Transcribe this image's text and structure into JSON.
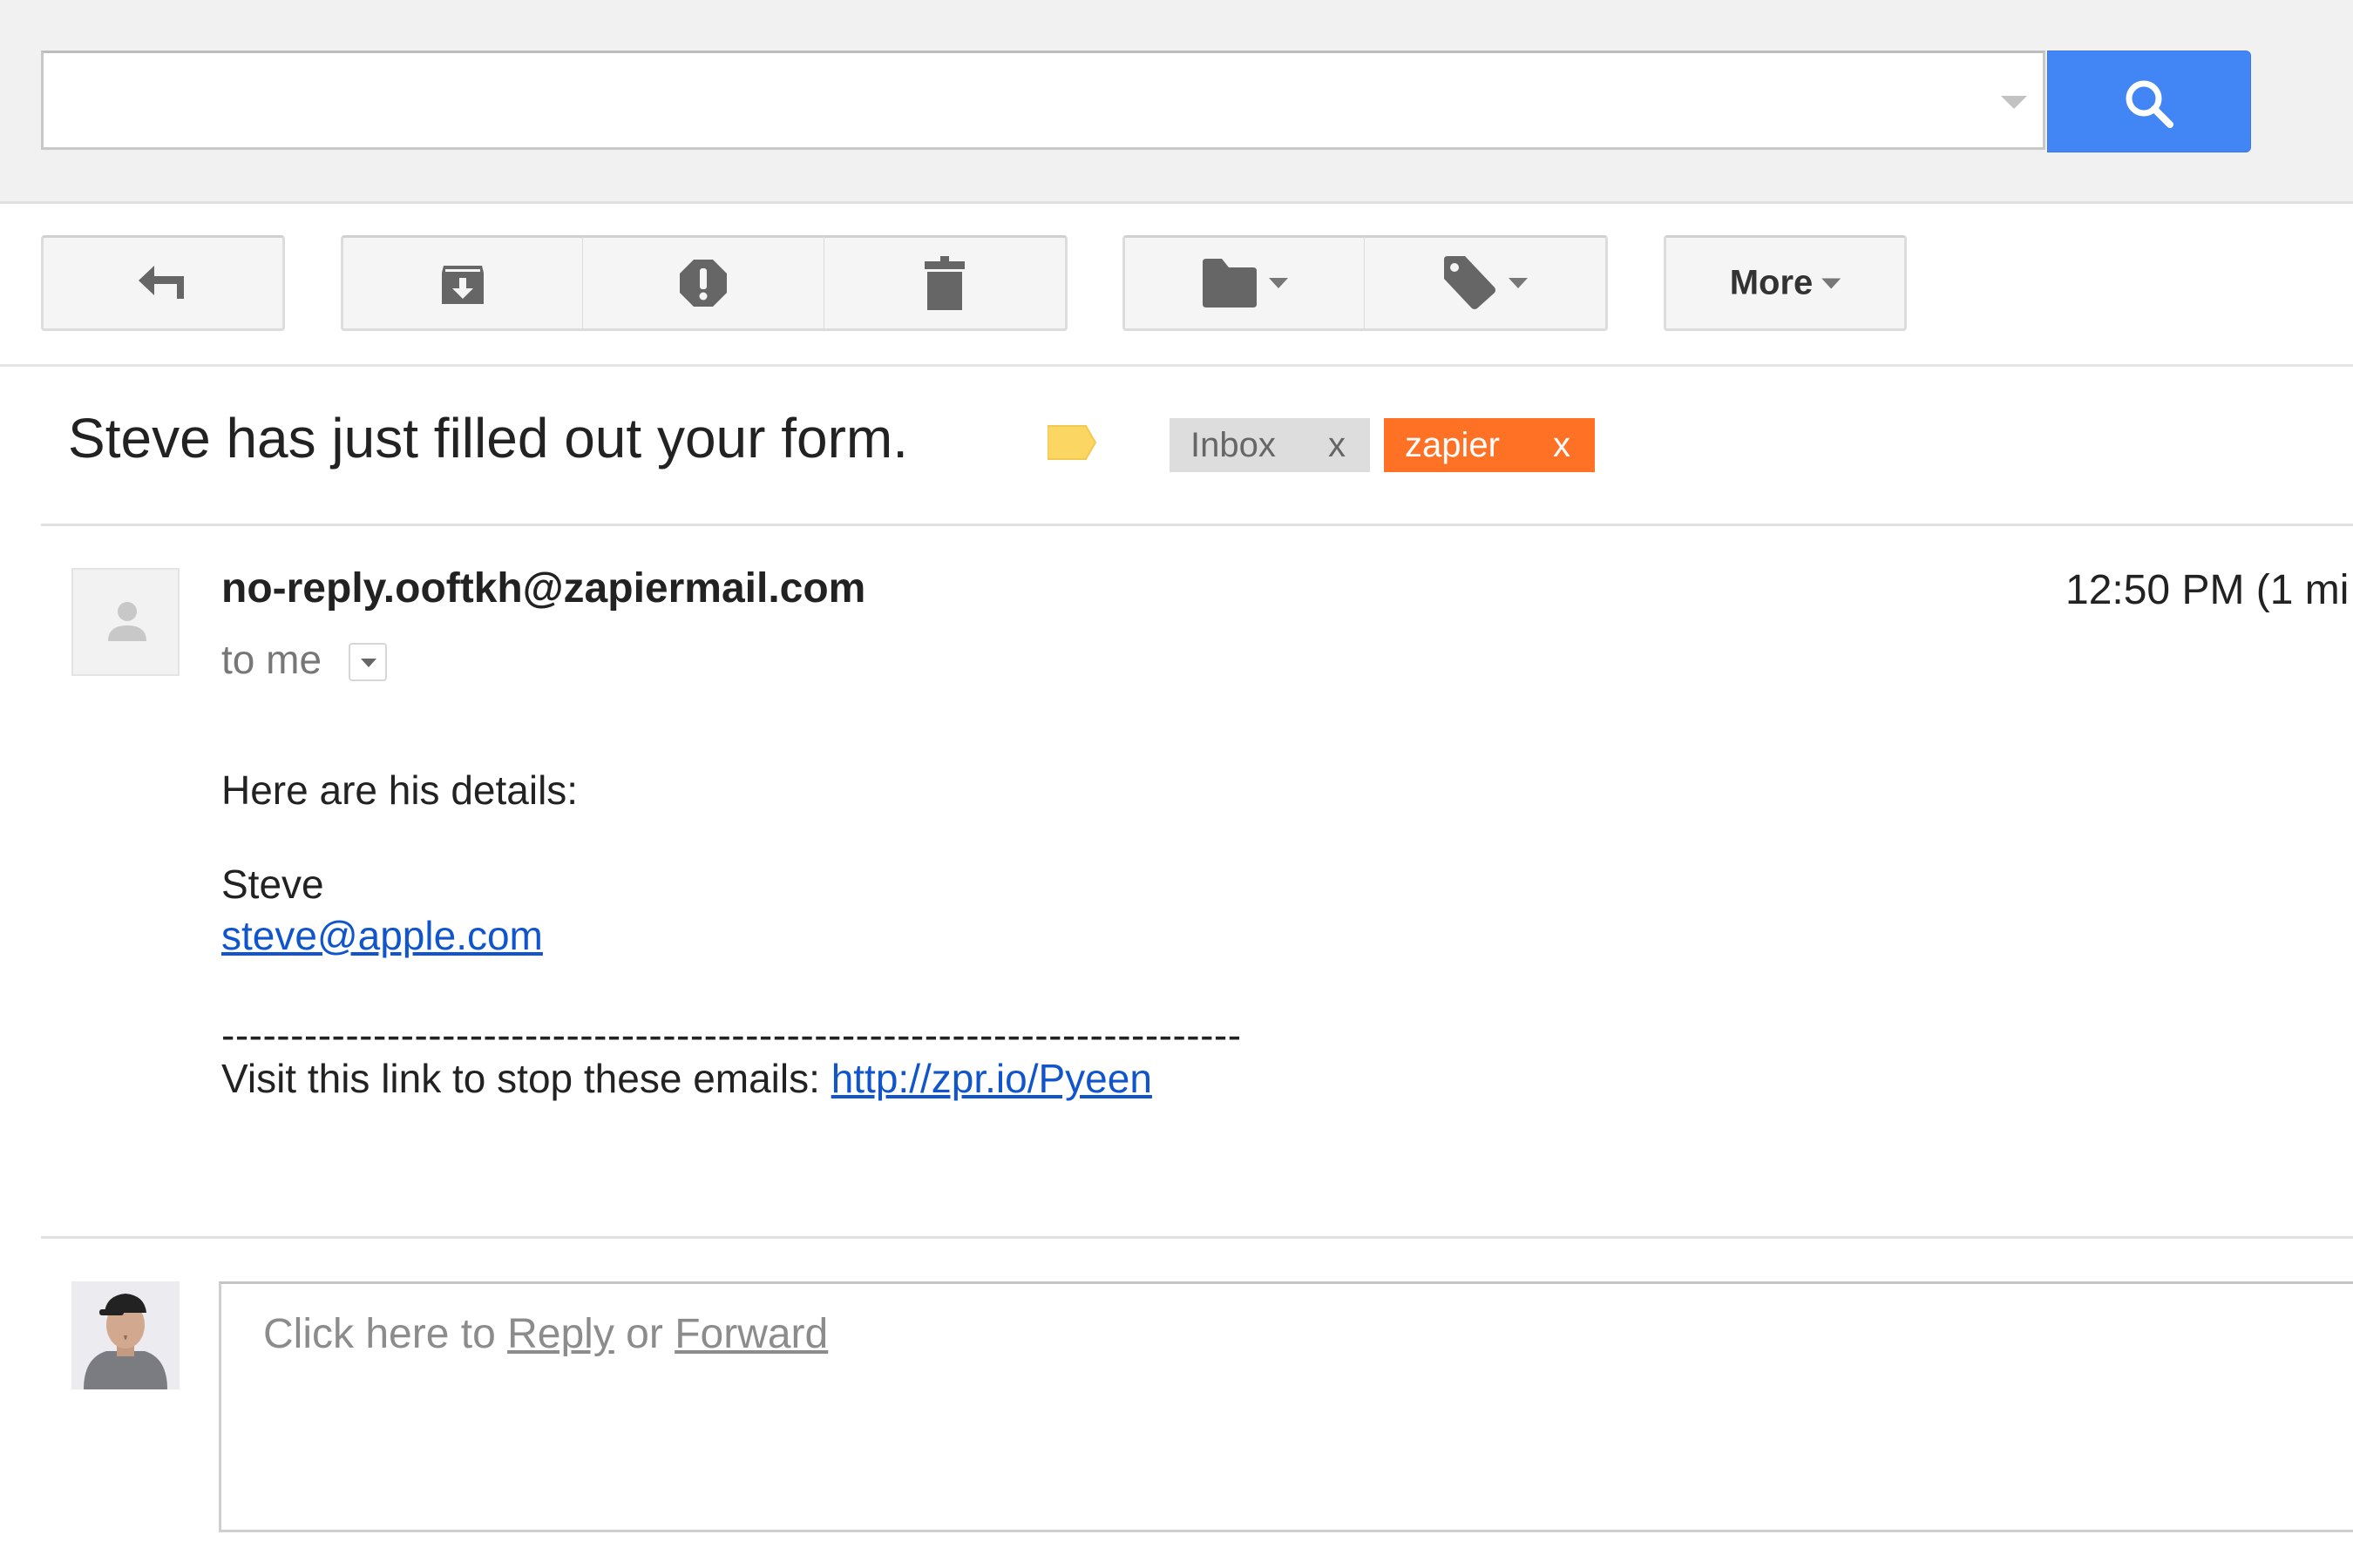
{
  "search": {
    "value": "",
    "placeholder": "",
    "button_icon": "search-icon",
    "accent_color": "#4285f4"
  },
  "toolbar": {
    "buttons": [
      {
        "name": "back",
        "icon": "back-arrow-icon"
      },
      {
        "name": "archive",
        "icon": "archive-icon"
      },
      {
        "name": "report-spam",
        "icon": "spam-icon"
      },
      {
        "name": "delete",
        "icon": "trash-icon"
      },
      {
        "name": "move-to",
        "icon": "folder-icon",
        "has_dropdown": true
      },
      {
        "name": "labels",
        "icon": "label-icon",
        "has_dropdown": true
      },
      {
        "name": "more",
        "icon": null,
        "has_dropdown": true
      }
    ],
    "more_label": "More"
  },
  "message": {
    "subject": "Steve has just filled out your form.",
    "important_marker_color": "#fcd663",
    "labels": [
      {
        "label": "Inbox",
        "remove": "x",
        "color": "#dddddd",
        "text_color": "#666666"
      },
      {
        "label": "zapier",
        "remove": "x",
        "color": "#ff7125",
        "text_color": "#ffffff"
      }
    ],
    "sender": "no-reply.ooftkh@zapiermail.com",
    "recipients": "to me",
    "timestamp": "12:50 PM (1 mi",
    "body": {
      "intro": "Here are his details:",
      "name": "Steve",
      "email_link": "steve@apple.com",
      "separator": "--------------------------------------------------------------------------",
      "unsubscribe_text": "Visit this link to stop these emails: ",
      "unsubscribe_link": "http://zpr.io/Pyeen"
    }
  },
  "reply": {
    "prefix": "Click here to ",
    "reply_link": "Reply",
    "middle": " or ",
    "forward_link": "Forward"
  }
}
